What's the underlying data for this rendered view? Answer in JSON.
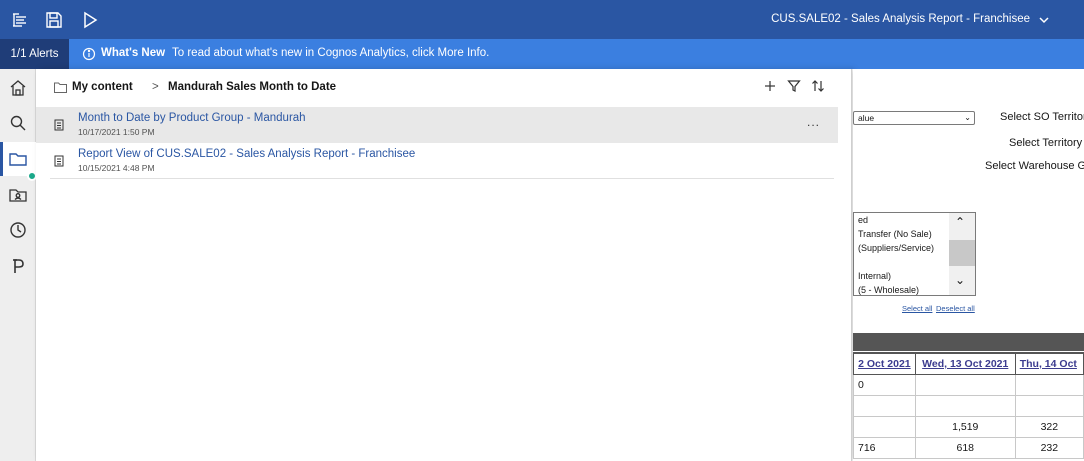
{
  "topbar": {
    "title": "CUS.SALE02 - Sales Analysis Report - Franchisee",
    "icons": [
      "menu-tree-icon",
      "save-icon",
      "run-icon",
      "chevron-down-icon"
    ]
  },
  "alerts": {
    "count_label": "1/1 Alerts",
    "heading": "What's New",
    "message": "To read about what's new in Cognos Analytics, click More Info."
  },
  "leftnav": {
    "items": [
      "home-icon",
      "search-icon",
      "folder-icon",
      "team-content-icon",
      "recent-icon",
      "p-icon"
    ]
  },
  "panel": {
    "breadcrumb_root": "My content",
    "breadcrumb_sep": ">",
    "breadcrumb_current": "Mandurah Sales Month to Date",
    "tools": [
      "add-icon",
      "filter-icon",
      "sort-icon"
    ],
    "items": [
      {
        "name": "Month to Date by Product Group - Mandurah",
        "date": "10/17/2021 1:50 PM",
        "more": "..."
      },
      {
        "name": "Report View of CUS.SALE02 - Sales Analysis Report - Franchisee",
        "date": "10/15/2021 4:48 PM"
      }
    ]
  },
  "report": {
    "select_value": "alue",
    "labels": [
      "Select SO Territor",
      "Select Territory",
      "Select Warehouse G"
    ],
    "list_options": [
      "ed",
      "Transfer (No Sale)",
      "(Suppliers/Service)",
      "",
      "Internal)",
      "(5 - Wholesale)"
    ],
    "select_all": "Select all",
    "deselect_all": "Deselect all",
    "columns": [
      "2 Oct 2021",
      "Wed, 13 Oct 2021",
      "Thu, 14 Oct"
    ],
    "rows": [
      [
        "0",
        "",
        ""
      ],
      [
        "",
        "",
        ""
      ],
      [
        "",
        "1,519",
        "322"
      ],
      [
        "716",
        "618",
        "232"
      ]
    ]
  }
}
